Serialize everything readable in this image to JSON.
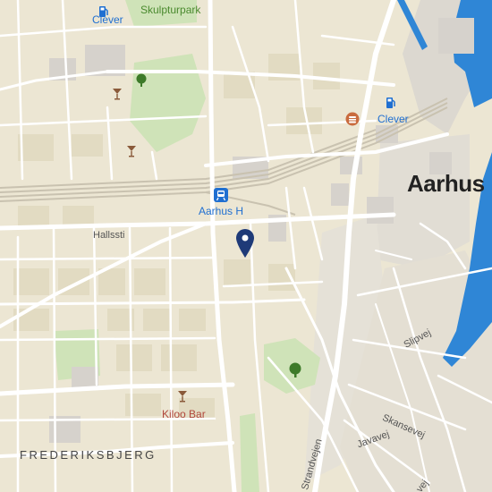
{
  "map": {
    "labels": {
      "clever_top": "Clever",
      "skulpturpark": "Skulpturpark",
      "clever_right": "Clever",
      "aarhus_h": "Aarhus H",
      "aarhus": "Aarhus",
      "hallssti": "Hallssti",
      "kiloo_bar": "Kiloo Bar",
      "frederiksbjerg": "FREDERIKSBJERG",
      "slipvej": "Slipvej",
      "skansevej": "Skansevej",
      "javavej": "Javavej",
      "strandvejen": "Strandvejen",
      "road_partial": "vej"
    },
    "icons": {
      "fuel": "fuel-icon",
      "train": "train-station-icon",
      "bar": "bar-icon",
      "park": "park-tree-icon",
      "food": "restaurant-icon",
      "marker": "location-pin-icon"
    },
    "colors": {
      "land": "#ece6d3",
      "block": "#e3dcc4",
      "road": "#ffffff",
      "park": "#cfe3b8",
      "water": "#2f86d6",
      "rail": "#c9c2b0",
      "industrial": "#d7d4cf",
      "poi_blue": "#1f6fd1",
      "marker": "#1e3a78"
    }
  }
}
